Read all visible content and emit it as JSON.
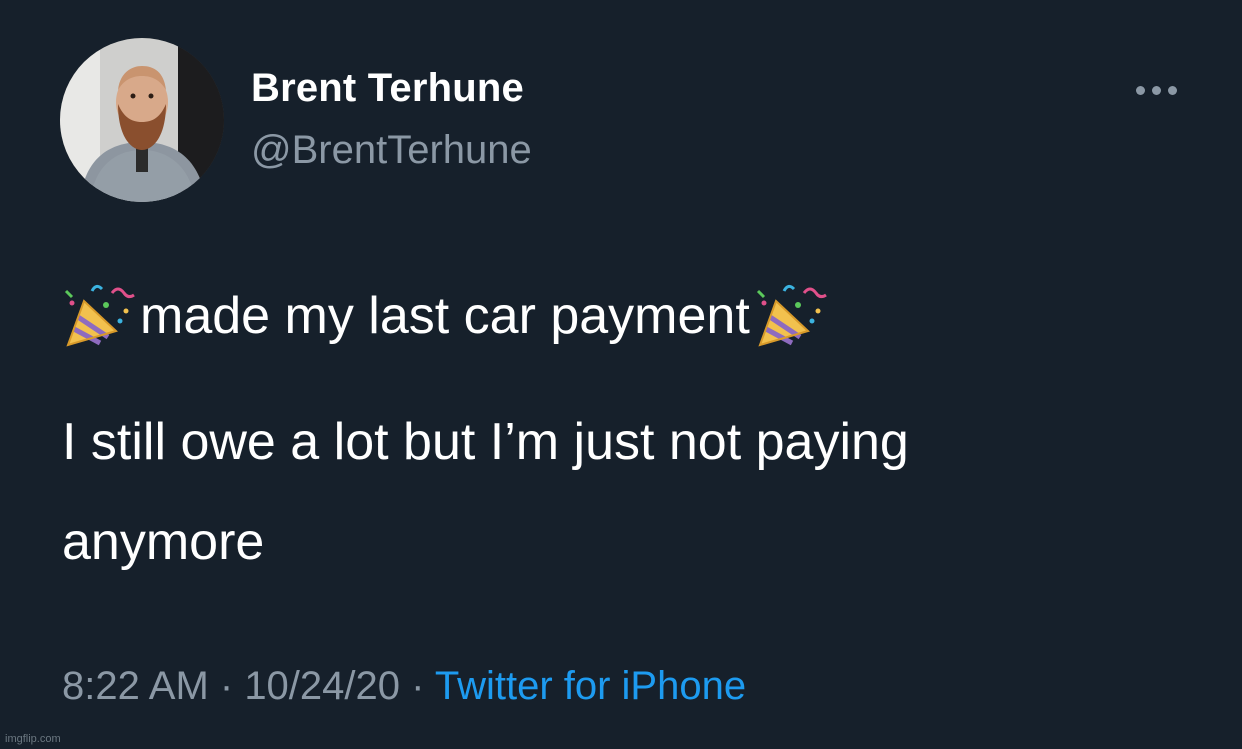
{
  "author": {
    "display_name": "Brent Terhune",
    "handle": "@BrentTerhune"
  },
  "tweet": {
    "line1_text": "made my last car payment",
    "line1_emoji": "party-popper-icon",
    "line2_text": "I still owe a lot but I’m just not paying",
    "line3_text": "anymore"
  },
  "meta": {
    "time": "8:22 AM",
    "separator1": " · ",
    "date": "10/24/20",
    "separator2": " · ",
    "source": "Twitter for iPhone"
  },
  "watermark": "imgflip.com",
  "colors": {
    "background": "#16202b",
    "text": "#ffffff",
    "secondary": "#8b98a5",
    "link": "#1d9bf0"
  },
  "icons": {
    "more": "more-horizontal-icon",
    "emoji": "party-popper-icon"
  }
}
